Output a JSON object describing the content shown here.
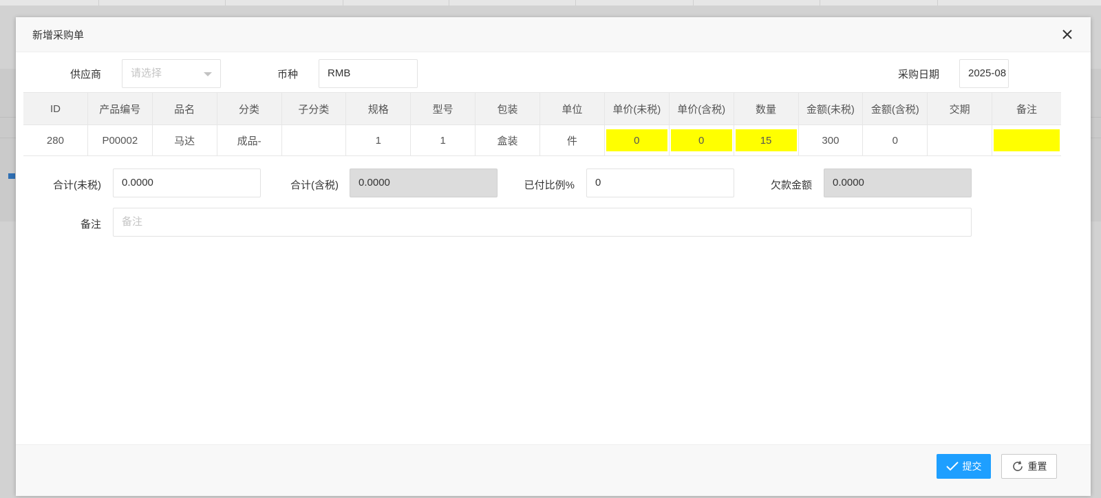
{
  "dialog": {
    "title": "新增采购单"
  },
  "form": {
    "supplier_label": "供应商",
    "supplier_placeholder": "请选择",
    "currency_label": "币种",
    "currency_value": "RMB",
    "date_label": "采购日期",
    "date_value": "2025-08"
  },
  "table": {
    "headers": [
      "ID",
      "产品编号",
      "品名",
      "分类",
      "子分类",
      "规格",
      "型号",
      "包装",
      "单位",
      "单价(未税)",
      "单价(含税)",
      "数量",
      "金额(未税)",
      "金额(含税)",
      "交期",
      "备注"
    ],
    "rows": [
      [
        "280",
        "P00002",
        "马达",
        "成品-",
        "",
        "1",
        "1",
        "盒装",
        "件",
        "0",
        "0",
        "15",
        "300",
        "0",
        "",
        ""
      ]
    ],
    "highlight_color": "#ffff00"
  },
  "totals": {
    "total_excl_tax_label": "合计(未税)",
    "total_excl_tax_value": "0.0000",
    "total_incl_tax_label": "合计(含税)",
    "total_incl_tax_value": "0.0000",
    "paid_ratio_label": "已付比例%",
    "paid_ratio_value": "0",
    "owed_label": "欠款金额",
    "owed_value": "0.0000",
    "remark_label": "备注",
    "remark_placeholder": "备注"
  },
  "footer": {
    "submit_label": "提交",
    "reset_label": "重置",
    "primary_color": "#1e9fff"
  },
  "icons": {
    "close": "close-icon",
    "check": "check-icon",
    "refresh": "refresh-icon",
    "dropdown": "chevron-down-icon"
  }
}
